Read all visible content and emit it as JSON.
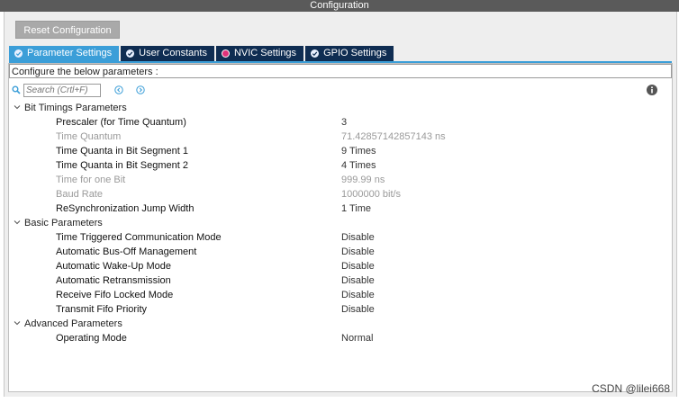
{
  "window": {
    "title": "Configuration"
  },
  "toolbar": {
    "reset_label": "Reset Configuration"
  },
  "tabs": [
    {
      "label": "Parameter Settings",
      "icon": "check-icon",
      "active": true
    },
    {
      "label": "User Constants",
      "icon": "check-icon",
      "active": false
    },
    {
      "label": "NVIC Settings",
      "icon": "pink-dot-icon",
      "active": false
    },
    {
      "label": "GPIO Settings",
      "icon": "check-icon",
      "active": false
    }
  ],
  "configure_label": "Configure the below parameters :",
  "search": {
    "placeholder": "Search (Crtl+F)"
  },
  "groups": [
    {
      "label": "Bit Timings Parameters",
      "params": [
        {
          "name": "Prescaler (for Time Quantum)",
          "value": "3",
          "enabled": true
        },
        {
          "name": "Time Quantum",
          "value": "71.42857142857143 ns",
          "enabled": false
        },
        {
          "name": "Time Quanta in Bit Segment 1",
          "value": "9 Times",
          "enabled": true
        },
        {
          "name": "Time Quanta in Bit Segment 2",
          "value": "4 Times",
          "enabled": true
        },
        {
          "name": "Time for one Bit",
          "value": "999.99 ns",
          "enabled": false
        },
        {
          "name": "Baud Rate",
          "value": "1000000 bit/s",
          "enabled": false
        },
        {
          "name": "ReSynchronization Jump Width",
          "value": "1 Time",
          "enabled": true
        }
      ]
    },
    {
      "label": "Basic Parameters",
      "params": [
        {
          "name": "Time Triggered Communication Mode",
          "value": "Disable",
          "enabled": true
        },
        {
          "name": "Automatic Bus-Off Management",
          "value": "Disable",
          "enabled": true
        },
        {
          "name": "Automatic Wake-Up Mode",
          "value": "Disable",
          "enabled": true
        },
        {
          "name": "Automatic Retransmission",
          "value": "Disable",
          "enabled": true
        },
        {
          "name": "Receive Fifo Locked Mode",
          "value": "Disable",
          "enabled": true
        },
        {
          "name": "Transmit Fifo Priority",
          "value": "Disable",
          "enabled": true
        }
      ]
    },
    {
      "label": "Advanced Parameters",
      "params": [
        {
          "name": "Operating Mode",
          "value": "Normal",
          "enabled": true
        }
      ]
    }
  ],
  "watermark": "CSDN @lilei668",
  "colors": {
    "active_tab": "#3b9ed8",
    "inactive_tab": "#0f2d52",
    "titlebar": "#5a5a5a"
  }
}
